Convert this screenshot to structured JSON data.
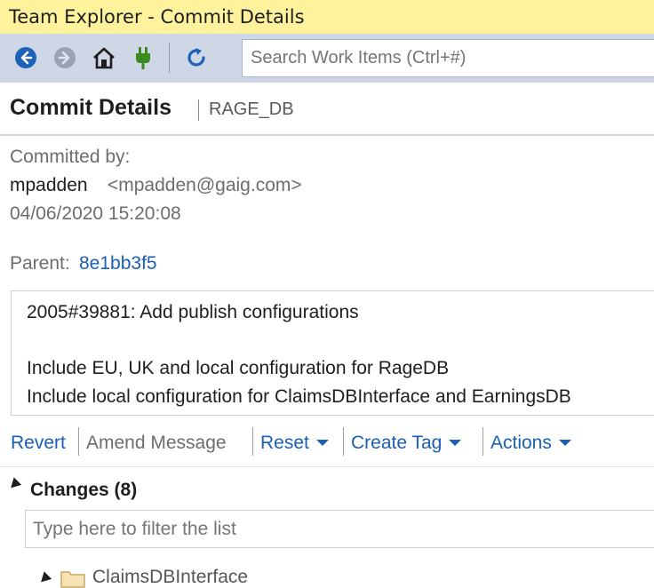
{
  "window": {
    "title": "Team Explorer - Commit Details"
  },
  "toolbar": {
    "search_placeholder": "Search Work Items (Ctrl+#)",
    "icons": [
      "back-icon",
      "forward-icon",
      "home-icon",
      "connect-icon",
      "refresh-icon"
    ]
  },
  "header": {
    "title": "Commit Details",
    "repo": "RAGE_DB"
  },
  "commit": {
    "committed_by_label": "Committed by:",
    "author_name": "mpadden",
    "author_email": "<mpadden@gaig.com>",
    "date": "04/06/2020 15:20:08",
    "parent_label": "Parent:",
    "parent_hash": "8e1bb3f5",
    "message_lines": [
      "2005#39881: Add publish configurations",
      "Include EU, UK and local configuration for RageDB",
      "Include local configuration for ClaimsDBInterface and EarningsDB"
    ]
  },
  "actions": {
    "revert": "Revert",
    "amend": "Amend Message",
    "reset": "Reset",
    "create_tag": "Create Tag",
    "actions": "Actions"
  },
  "changes": {
    "title": "Changes (8)",
    "filter_placeholder": "Type here to filter the list",
    "first_folder": "ClaimsDBInterface"
  },
  "colors": {
    "titlebar_bg": "#fff29d",
    "toolbar_bg": "#cfd6e5",
    "accent": "#1a5fb4",
    "connect_green": "#3a8a1e"
  }
}
